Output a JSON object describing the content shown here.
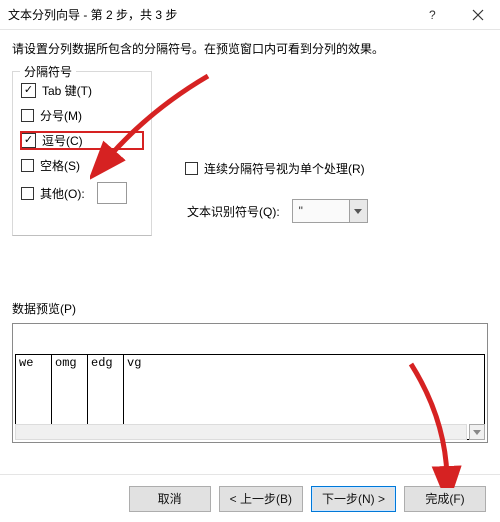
{
  "window": {
    "title": "文本分列向导 - 第 2 步，共 3 步",
    "question_icon": "?",
    "close_icon": "×"
  },
  "instruction": "请设置分列数据所包含的分隔符号。在预览窗口内可看到分列的效果。",
  "delimiters": {
    "legend": "分隔符号",
    "tab": {
      "label": "Tab 键(T)",
      "checked": true
    },
    "semicolon": {
      "label": "分号(M)",
      "checked": false
    },
    "comma": {
      "label": "逗号(C)",
      "checked": true
    },
    "space": {
      "label": "空格(S)",
      "checked": false
    },
    "other": {
      "label": "其他(O):",
      "checked": false,
      "value": ""
    }
  },
  "options": {
    "consecutive": {
      "label": "连续分隔符号视为单个处理(R)",
      "checked": false
    },
    "qualifier": {
      "label": "文本识别符号(Q):",
      "value": "\""
    }
  },
  "preview": {
    "label": "数据预览(P)",
    "columns": [
      "we",
      "omg",
      "edg",
      "vg"
    ]
  },
  "buttons": {
    "cancel": "取消",
    "back": "< 上一步(B)",
    "next": "下一步(N) >",
    "finish": "完成(F)"
  },
  "annotation": {
    "arrow_color": "#d62222"
  }
}
